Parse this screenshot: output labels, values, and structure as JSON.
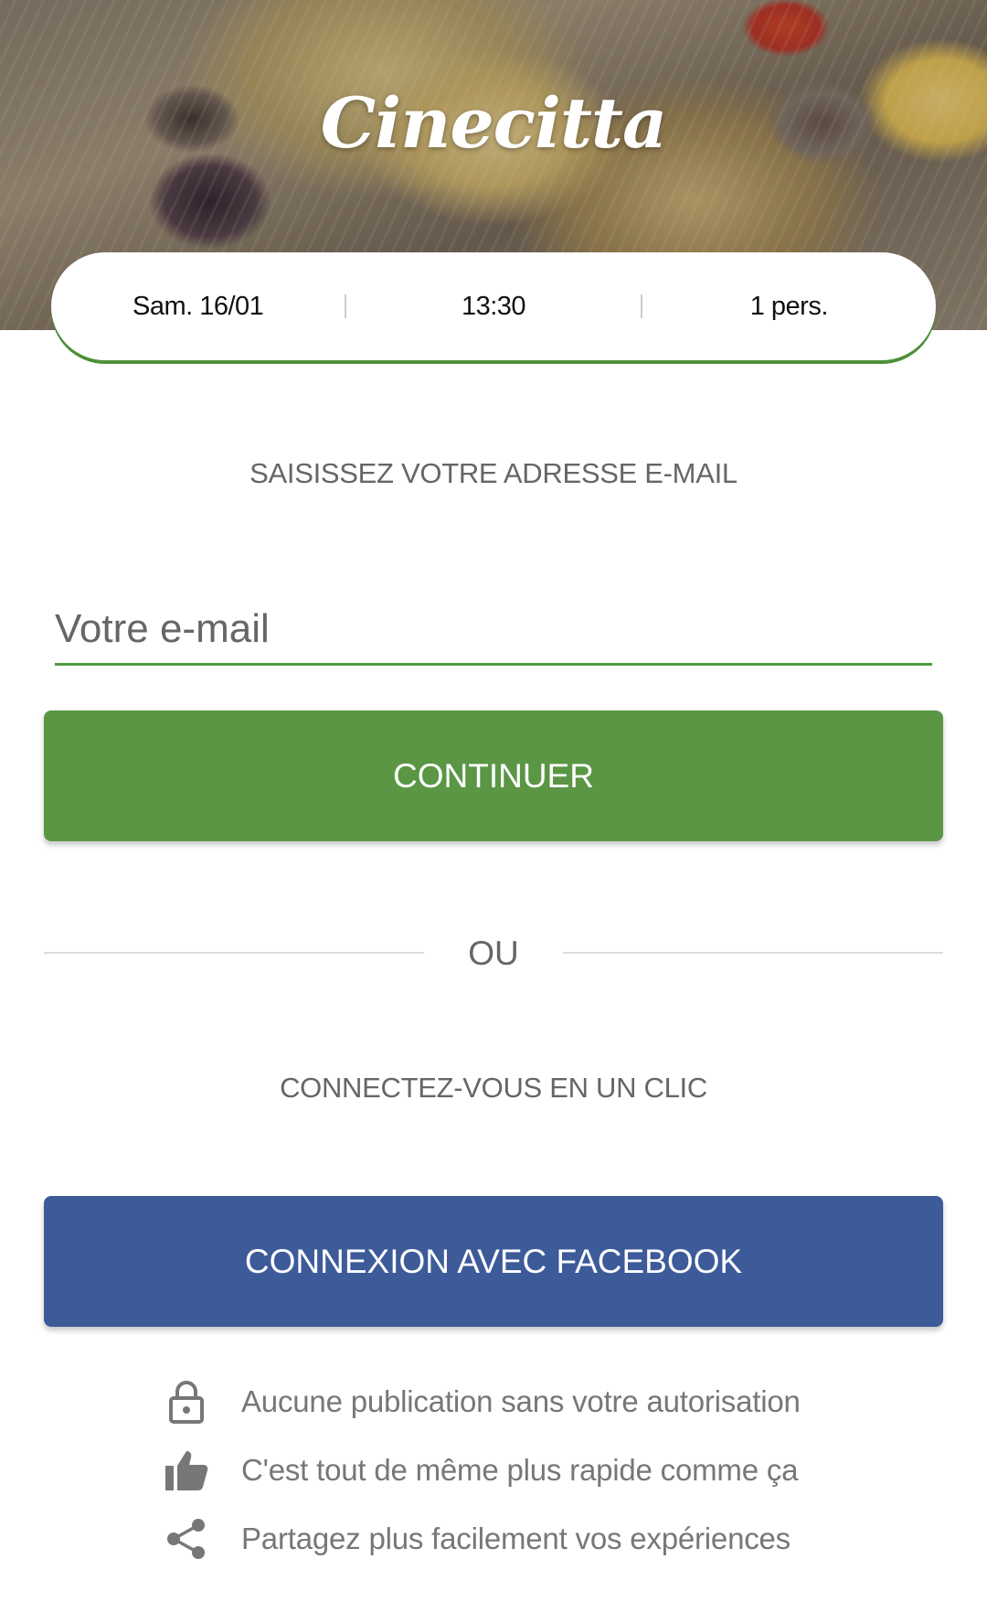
{
  "header": {
    "logo_text": "Cinecitta"
  },
  "booking": {
    "date": "Sam. 16/01",
    "time": "13:30",
    "guests": "1 pers."
  },
  "email_section": {
    "prompt": "SAISISSEZ VOTRE ADRESSE E-MAIL",
    "placeholder": "Votre e-mail",
    "value": "",
    "continue_label": "CONTINUER"
  },
  "divider": {
    "label": "OU"
  },
  "social": {
    "heading": "CONNECTEZ-VOUS EN UN CLIC",
    "facebook_label": "CONNEXION AVEC FACEBOOK",
    "facebook_color": "#3d5a99"
  },
  "benefits": [
    {
      "icon": "lock-icon",
      "text": "Aucune publication sans votre autorisation"
    },
    {
      "icon": "thumbs-up-icon",
      "text": "C'est tout de même plus rapide comme ça"
    },
    {
      "icon": "share-icon",
      "text": "Partagez plus facilement vos expériences"
    }
  ],
  "colors": {
    "accent": "#5a9644",
    "facebook": "#3d5a99",
    "muted_text": "#666666"
  }
}
